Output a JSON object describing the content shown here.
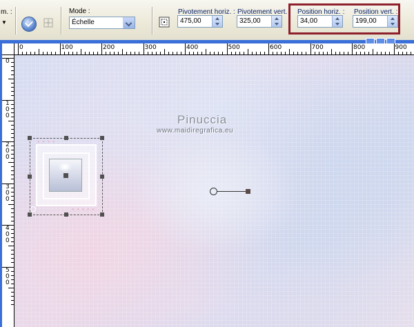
{
  "toolbar": {
    "cut_label": "m. :",
    "mode": {
      "label": "Mode :",
      "value": "Échelle"
    },
    "pivot_h": {
      "label": "Pivotement horiz. :",
      "value": "475,00"
    },
    "pivot_v": {
      "label": "Pivotement vert. :",
      "value": "325,00"
    },
    "pos_h": {
      "label": "Position horiz. :",
      "value": "34,00"
    },
    "pos_v": {
      "label": "Position vert. :",
      "value": "199,00"
    },
    "highlight_color": "#8E1F2B"
  },
  "ruler": {
    "top_labels": [
      "0",
      "100",
      "200",
      "300",
      "400",
      "500",
      "600",
      "700",
      "800",
      "900"
    ],
    "left_labels": [
      "0",
      "1 0 0",
      "2 0 0",
      "3 0 0",
      "4 0 0",
      "5 0 0"
    ]
  },
  "canvas": {
    "watermark_title": "Pinuccia",
    "watermark_url": "www.maidiregrafica.eu"
  },
  "icons": [
    "ok-icon",
    "grid-icon",
    "pivot-icon",
    "dropdown-arrow-icon"
  ]
}
